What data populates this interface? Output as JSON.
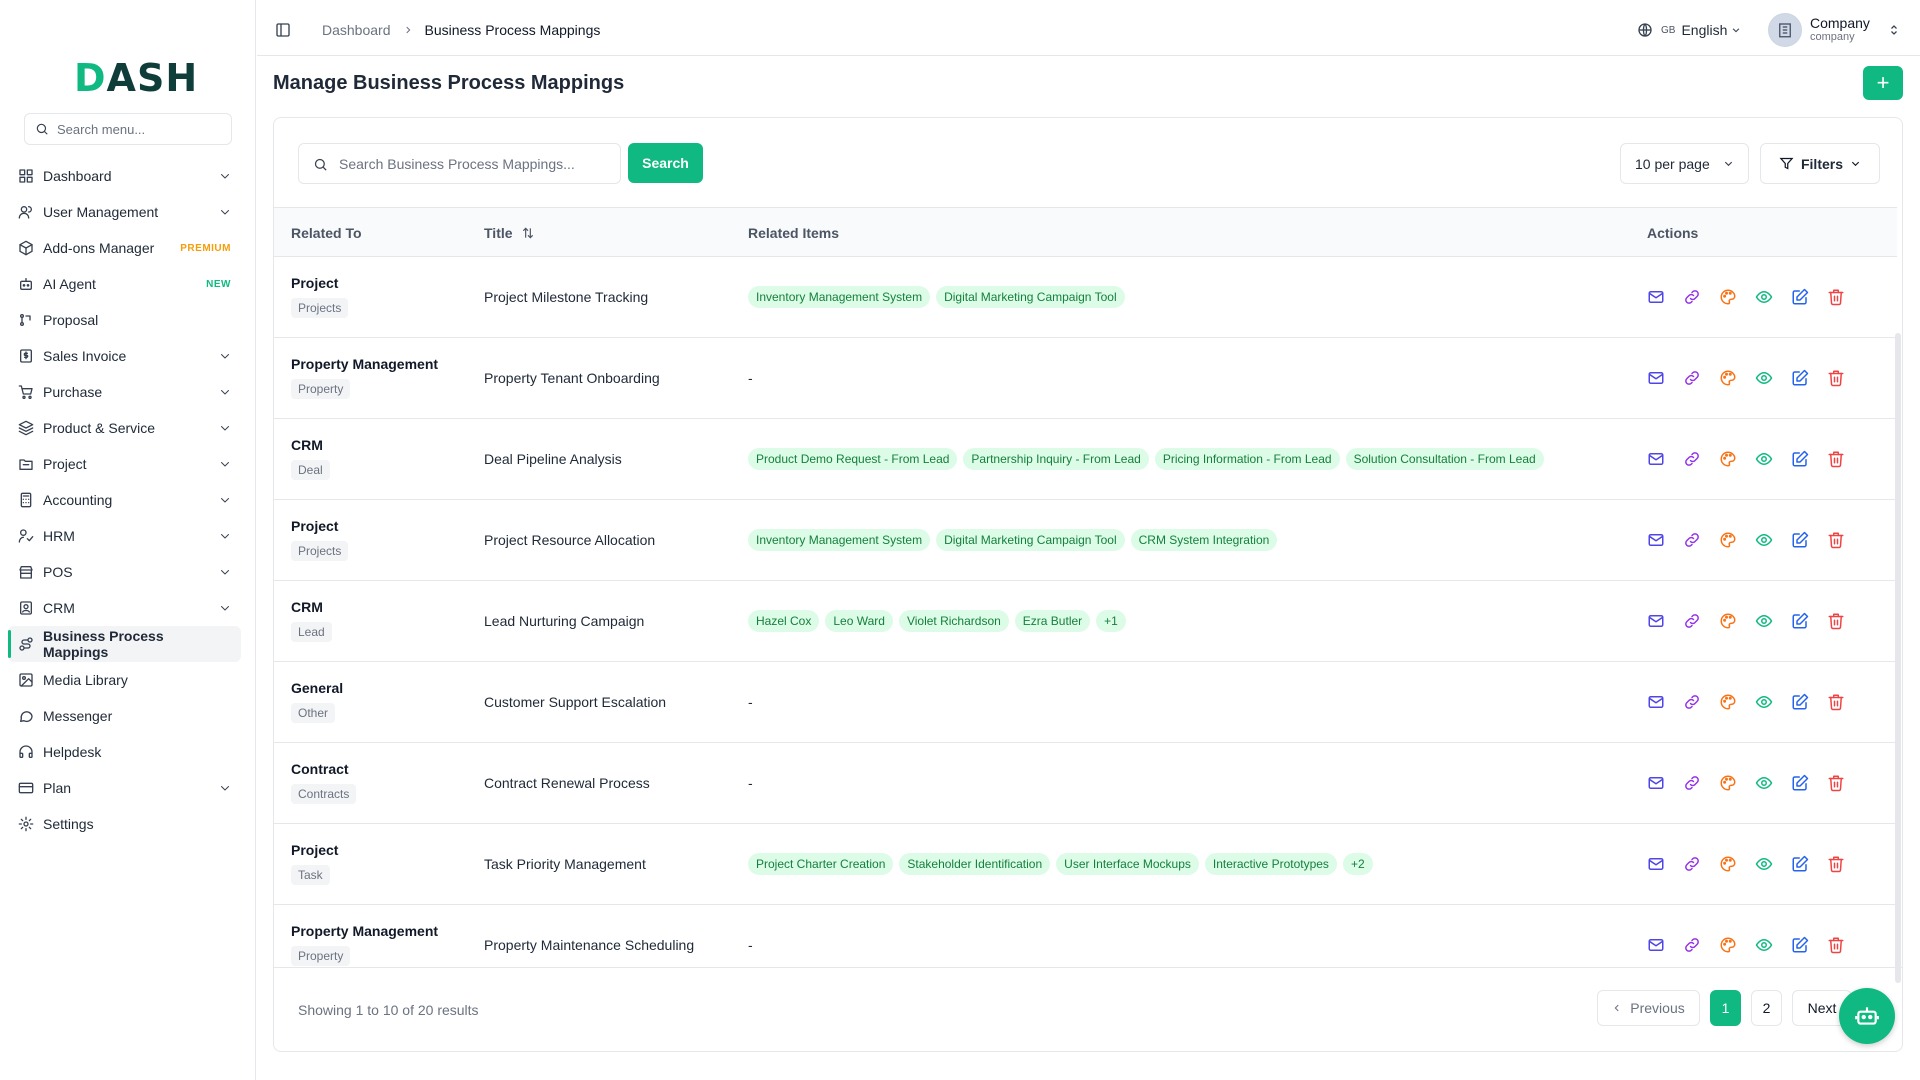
{
  "app": {
    "logo_prefix": "D",
    "logo_rest": "ASH",
    "search_placeholder": "Search menu..."
  },
  "sidebar": {
    "items": [
      {
        "label": "Dashboard",
        "icon": "grid-icon",
        "chevron": true
      },
      {
        "label": "User Management",
        "icon": "users-icon",
        "chevron": true
      },
      {
        "label": "Add-ons Manager",
        "icon": "package-icon",
        "badge": "PREMIUM"
      },
      {
        "label": "AI Agent",
        "icon": "bot-icon",
        "badge": "NEW"
      },
      {
        "label": "Proposal",
        "icon": "proposal-icon"
      },
      {
        "label": "Sales Invoice",
        "icon": "invoice-icon",
        "chevron": true
      },
      {
        "label": "Purchase",
        "icon": "cart-icon",
        "chevron": true
      },
      {
        "label": "Product & Service",
        "icon": "layers-icon",
        "chevron": true
      },
      {
        "label": "Project",
        "icon": "folder-icon",
        "chevron": true
      },
      {
        "label": "Accounting",
        "icon": "calculator-icon",
        "chevron": true
      },
      {
        "label": "HRM",
        "icon": "hrm-icon",
        "chevron": true
      },
      {
        "label": "POS",
        "icon": "store-icon",
        "chevron": true
      },
      {
        "label": "CRM",
        "icon": "contact-icon",
        "chevron": true
      },
      {
        "label": "Business Process Mappings",
        "icon": "route-icon",
        "active": true
      },
      {
        "label": "Media Library",
        "icon": "image-icon"
      },
      {
        "label": "Messenger",
        "icon": "chat-icon"
      },
      {
        "label": "Helpdesk",
        "icon": "headset-icon"
      },
      {
        "label": "Plan",
        "icon": "card-icon",
        "chevron": true
      },
      {
        "label": "Settings",
        "icon": "gear-icon"
      }
    ]
  },
  "header": {
    "breadcrumb_root": "Dashboard",
    "breadcrumb_current": "Business Process Mappings",
    "lang_code": "GB",
    "lang_label": "English",
    "company_name": "Company",
    "company_sub": "company"
  },
  "page": {
    "title": "Manage Business Process Mappings",
    "add_label": "+"
  },
  "toolbar": {
    "search_placeholder": "Search Business Process Mappings...",
    "search_button": "Search",
    "per_page": "10 per page",
    "filters": "Filters"
  },
  "table": {
    "headers": {
      "related_to": "Related To",
      "title": "Title",
      "related_items": "Related Items",
      "actions": "Actions"
    },
    "rows": [
      {
        "rel": "Project",
        "tag": "Projects",
        "title": "Project Milestone Tracking",
        "items": [
          "Inventory Management System",
          "Digital Marketing Campaign Tool"
        ]
      },
      {
        "rel": "Property Management",
        "tag": "Property",
        "title": "Property Tenant Onboarding",
        "items": []
      },
      {
        "rel": "CRM",
        "tag": "Deal",
        "title": "Deal Pipeline Analysis",
        "items": [
          "Product Demo Request - From Lead",
          "Partnership Inquiry - From Lead",
          "Pricing Information - From Lead",
          "Solution Consultation - From Lead"
        ]
      },
      {
        "rel": "Project",
        "tag": "Projects",
        "title": "Project Resource Allocation",
        "items": [
          "Inventory Management System",
          "Digital Marketing Campaign Tool",
          "CRM System Integration"
        ]
      },
      {
        "rel": "CRM",
        "tag": "Lead",
        "title": "Lead Nurturing Campaign",
        "items": [
          "Hazel Cox",
          "Leo Ward",
          "Violet Richardson",
          "Ezra Butler",
          "+1"
        ]
      },
      {
        "rel": "General",
        "tag": "Other",
        "title": "Customer Support Escalation",
        "items": []
      },
      {
        "rel": "Contract",
        "tag": "Contracts",
        "title": "Contract Renewal Process",
        "items": []
      },
      {
        "rel": "Project",
        "tag": "Task",
        "title": "Task Priority Management",
        "items": [
          "Project Charter Creation",
          "Stakeholder Identification",
          "User Interface Mockups",
          "Interactive Prototypes",
          "+2"
        ]
      },
      {
        "rel": "Property Management",
        "tag": "Property",
        "title": "Property Maintenance Scheduling",
        "items": []
      }
    ],
    "empty_marker": "-"
  },
  "footer": {
    "showing": "Showing 1 to 10 of 20 results",
    "prev": "Previous",
    "pages": [
      "1",
      "2"
    ],
    "current_page": "1",
    "next": "Next"
  },
  "colors": {
    "accent": "#10b981",
    "mail": "#4f46e5",
    "link": "#9333ea",
    "palette": "#f97316",
    "eye": "#10b981",
    "edit": "#2563eb",
    "trash": "#ef4444"
  }
}
